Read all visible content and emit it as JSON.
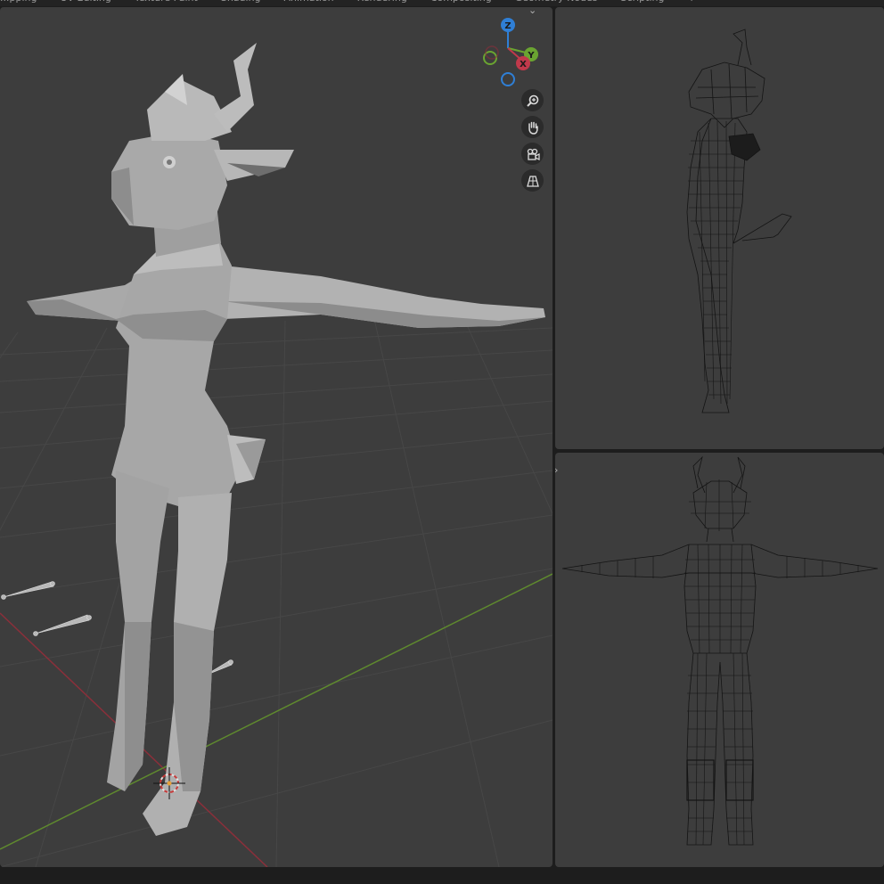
{
  "workspace_tabs": [
    "...pping",
    "UV Editing",
    "Texture Paint",
    "Shading",
    "Animation",
    "Rendering",
    "Compositing",
    "Geometry Nodes",
    "Scripting",
    "+"
  ],
  "gizmo": {
    "z_label": "Z",
    "y_label": "Y",
    "x_label": "X"
  },
  "nav_buttons": [
    "zoom-icon",
    "hand-pan-icon",
    "camera-icon",
    "perspective-grid-icon"
  ],
  "colors": {
    "viewport_bg": "#3d3d3d",
    "axis_x": "#c0394b",
    "axis_y": "#6aa431",
    "axis_z": "#2f7fd6",
    "mesh": "#9b9b9b",
    "wire": "#111111"
  }
}
